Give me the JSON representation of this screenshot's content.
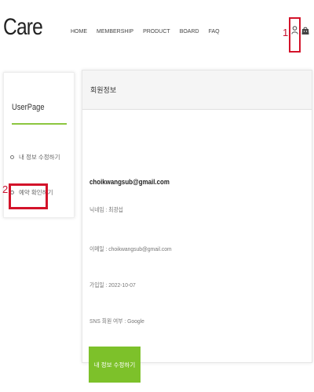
{
  "header": {
    "logo": "Care",
    "nav": [
      "HOME",
      "MEMBERSHIP",
      "PRODUCT",
      "BOARD",
      "FAQ"
    ],
    "marker": "1.",
    "icons": [
      "user-icon",
      "shopping-bag-icon"
    ]
  },
  "sidebar": {
    "title": "UserPage",
    "items": [
      {
        "label": "내 정보 수정하기"
      },
      {
        "label": "예약 확인하기"
      }
    ],
    "marker": "2."
  },
  "card": {
    "title": "회원정보",
    "email_strong": "choikwangsub@gmail.com",
    "nickname": "닉네임 : 최광섭",
    "email": "이메일 : choikwangsub@gmail.com",
    "joined": "가입일 : 2022-10-07",
    "sns": "SNS 회원 여부 : Google",
    "edit_button": "내 정보 수정하기"
  },
  "colors": {
    "accent_green": "#7dc12a",
    "highlight_red": "#d3132a",
    "divider_green": "#8cc63f"
  }
}
